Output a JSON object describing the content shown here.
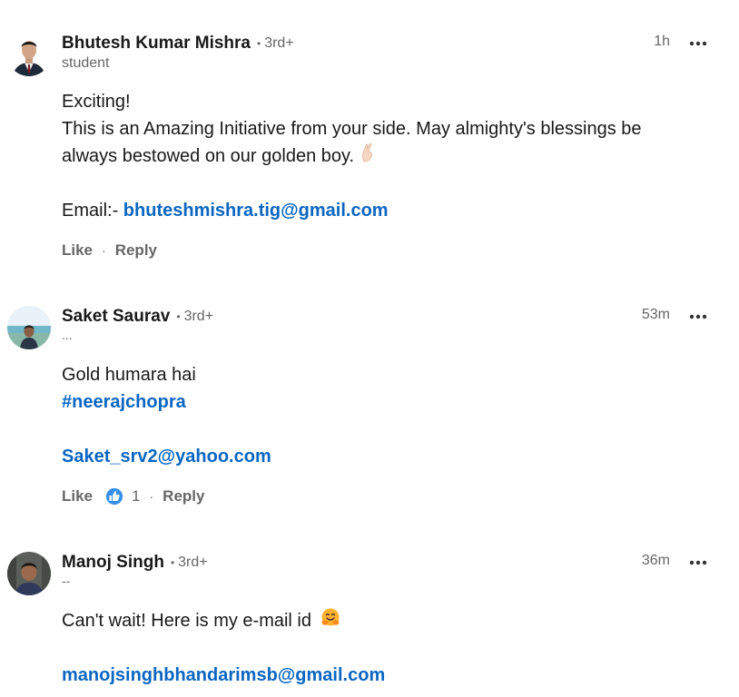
{
  "comments": [
    {
      "author": "Bhutesh Kumar Mishra",
      "degree_sep": "•",
      "degree": "3rd+",
      "headline": "student",
      "time": "1h",
      "avatar_icon": "profile-photo",
      "body": {
        "line1": "Exciting!",
        "line2": "This is an Amazing Initiative from your side. May almighty's blessings be",
        "line3": "always bestowed on our golden boy.",
        "line3_emoji": "crossed-fingers-emoji",
        "email_prefix": "Email:- ",
        "email": "bhuteshmishra.tig@gmail.com"
      },
      "actions": {
        "like": "Like",
        "sep": "·",
        "reply": "Reply"
      }
    },
    {
      "author": "Saket Saurav",
      "degree_sep": "•",
      "degree": "3rd+",
      "headline": "...",
      "time": "53m",
      "avatar_icon": "profile-photo",
      "body": {
        "line1": "Gold humara hai",
        "hashtag": "#neerajchopra",
        "email": "Saket_srv2@yahoo.com"
      },
      "actions": {
        "like": "Like",
        "reaction_count": "1",
        "reaction_icon": "thumbs-up-icon",
        "sep": "·",
        "reply": "Reply"
      }
    },
    {
      "author": "Manoj Singh",
      "degree_sep": "•",
      "degree": "3rd+",
      "headline": "--",
      "time": "36m",
      "avatar_icon": "profile-photo",
      "body": {
        "line1": "Can't wait! Here is my e-mail id",
        "line1_emoji": "hugging-face-emoji",
        "email": "manojsinghbhandarimsb@gmail.com"
      }
    }
  ],
  "colors": {
    "link": "#0a66c2",
    "text": "#191919",
    "muted": "#666666"
  }
}
